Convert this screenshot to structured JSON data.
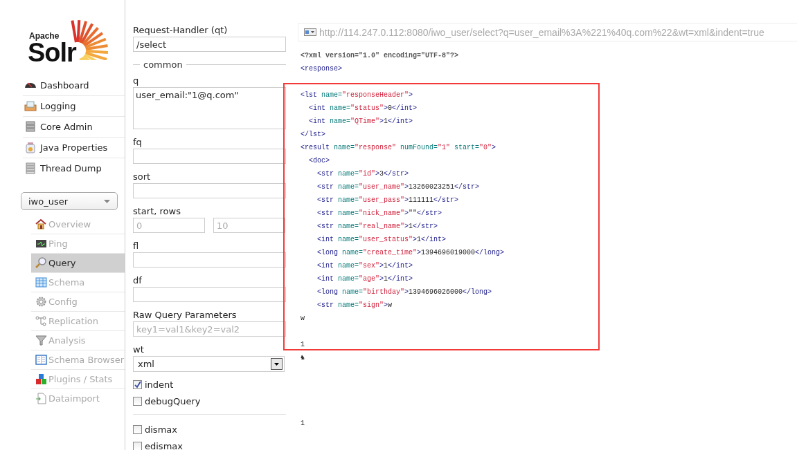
{
  "logo": {
    "small": "Apache",
    "big": "Solr"
  },
  "nav": [
    {
      "label": "Dashboard"
    },
    {
      "label": "Logging"
    },
    {
      "label": "Core Admin"
    },
    {
      "label": "Java Properties"
    },
    {
      "label": "Thread Dump"
    }
  ],
  "core_selector": {
    "value": "iwo_user"
  },
  "core_menu": [
    {
      "label": "Overview",
      "selected": false
    },
    {
      "label": "Ping",
      "selected": false
    },
    {
      "label": "Query",
      "selected": true
    },
    {
      "label": "Schema",
      "selected": false
    },
    {
      "label": "Config",
      "selected": false
    },
    {
      "label": "Replication",
      "selected": false
    },
    {
      "label": "Analysis",
      "selected": false
    },
    {
      "label": "Schema Browser",
      "selected": false
    },
    {
      "label": "Plugins / Stats",
      "selected": false
    },
    {
      "label": "Dataimport",
      "selected": false
    }
  ],
  "form": [
    {
      "kind": "text",
      "label": "Request-Handler (qt)",
      "value": "/select"
    },
    {
      "kind": "legend",
      "label": "common"
    },
    {
      "kind": "textarea",
      "label": "q",
      "value": "user_email:\"1@q.com\""
    },
    {
      "kind": "text",
      "label": "fq"
    },
    {
      "kind": "text",
      "label": "sort"
    },
    {
      "kind": "pair",
      "label": "start, rows",
      "placeholders": [
        "0",
        "10"
      ]
    },
    {
      "kind": "text",
      "label": "fl"
    },
    {
      "kind": "text",
      "label": "df"
    },
    {
      "kind": "text",
      "label": "Raw Query Parameters",
      "placeholder": "key1=val1&key2=val2"
    },
    {
      "kind": "select",
      "label": "wt",
      "value": "xml"
    },
    {
      "kind": "checkbox",
      "label": "indent",
      "checked": true
    },
    {
      "kind": "checkbox",
      "label": "debugQuery",
      "checked": false
    },
    {
      "kind": "divider"
    },
    {
      "kind": "checkbox",
      "label": "dismax",
      "checked": false
    },
    {
      "kind": "checkbox",
      "label": "edismax",
      "checked": false
    }
  ],
  "url": "http://114.247.0.112:8080/iwo_user/select?q=user_email%3A%221%40q.com%22&wt=xml&indent=true",
  "result": [
    {
      "kind": "line",
      "parts": [
        {
          "kind": "decl",
          "text": "<?xml version=\"1.0\" encoding=\"UTF-8\"?>"
        }
      ]
    },
    {
      "kind": "line",
      "parts": [
        {
          "kind": "tag",
          "text": "<response>"
        }
      ]
    },
    {
      "kind": "blank"
    },
    {
      "kind": "line",
      "parts": [
        {
          "kind": "tag",
          "text": "<lst "
        },
        {
          "kind": "attr",
          "text": "name="
        },
        {
          "kind": "value",
          "text": "\"responseHeader\""
        },
        {
          "kind": "tag",
          "text": ">"
        }
      ],
      "children": [
        {
          "kind": "line",
          "parts": [
            {
              "kind": "tag",
              "text": "<int "
            },
            {
              "kind": "attr",
              "text": "name="
            },
            {
              "kind": "value",
              "text": "\"status\""
            },
            {
              "kind": "tag",
              "text": ">"
            },
            {
              "kind": "text",
              "text": "0"
            },
            {
              "kind": "tag",
              "text": "</int>"
            }
          ]
        },
        {
          "kind": "line",
          "parts": [
            {
              "kind": "tag",
              "text": "<int "
            },
            {
              "kind": "attr",
              "text": "name="
            },
            {
              "kind": "value",
              "text": "\"QTime\""
            },
            {
              "kind": "tag",
              "text": ">"
            },
            {
              "kind": "text",
              "text": "1"
            },
            {
              "kind": "tag",
              "text": "</int>"
            }
          ]
        }
      ]
    },
    {
      "kind": "line",
      "parts": [
        {
          "kind": "tag",
          "text": "</lst>"
        }
      ]
    },
    {
      "kind": "line",
      "parts": [
        {
          "kind": "tag",
          "text": "<result "
        },
        {
          "kind": "attr",
          "text": "name="
        },
        {
          "kind": "value",
          "text": "\"response\""
        },
        {
          "kind": "attr",
          "text": " numFound="
        },
        {
          "kind": "value",
          "text": "\"1\""
        },
        {
          "kind": "attr",
          "text": " start="
        },
        {
          "kind": "value",
          "text": "\"0\""
        },
        {
          "kind": "tag",
          "text": ">"
        }
      ],
      "children": [
        {
          "kind": "line",
          "parts": [
            {
              "kind": "tag",
              "text": "<doc>"
            }
          ],
          "children": [
            {
              "kind": "line",
              "parts": [
                {
                  "kind": "tag",
                  "text": "<str "
                },
                {
                  "kind": "attr",
                  "text": "name="
                },
                {
                  "kind": "value",
                  "text": "\"id\""
                },
                {
                  "kind": "tag",
                  "text": ">"
                },
                {
                  "kind": "text",
                  "text": "3"
                },
                {
                  "kind": "tag",
                  "text": "</str>"
                }
              ]
            },
            {
              "kind": "line",
              "parts": [
                {
                  "kind": "tag",
                  "text": "<str "
                },
                {
                  "kind": "attr",
                  "text": "name="
                },
                {
                  "kind": "value",
                  "text": "\"user_name\""
                },
                {
                  "kind": "tag",
                  "text": ">"
                },
                {
                  "kind": "text",
                  "text": "13260023251"
                },
                {
                  "kind": "tag",
                  "text": "</str>"
                }
              ]
            },
            {
              "kind": "line",
              "parts": [
                {
                  "kind": "tag",
                  "text": "<str "
                },
                {
                  "kind": "attr",
                  "text": "name="
                },
                {
                  "kind": "value",
                  "text": "\"user_pass\""
                },
                {
                  "kind": "tag",
                  "text": ">"
                },
                {
                  "kind": "text",
                  "text": "111111"
                },
                {
                  "kind": "tag",
                  "text": "</str>"
                }
              ]
            },
            {
              "kind": "line",
              "parts": [
                {
                  "kind": "tag",
                  "text": "<str "
                },
                {
                  "kind": "attr",
                  "text": "name="
                },
                {
                  "kind": "value",
                  "text": "\"nick_name\""
                },
                {
                  "kind": "tag",
                  "text": ">"
                },
                {
                  "kind": "text",
                  "text": "\"\""
                },
                {
                  "kind": "tag",
                  "text": "</str>"
                }
              ]
            },
            {
              "kind": "line",
              "parts": [
                {
                  "kind": "tag",
                  "text": "<str "
                },
                {
                  "kind": "attr",
                  "text": "name="
                },
                {
                  "kind": "value",
                  "text": "\"real_name\""
                },
                {
                  "kind": "tag",
                  "text": ">"
                },
                {
                  "kind": "text",
                  "text": "1"
                },
                {
                  "kind": "tag",
                  "text": "</str>"
                }
              ]
            },
            {
              "kind": "line",
              "parts": [
                {
                  "kind": "tag",
                  "text": "<int "
                },
                {
                  "kind": "attr",
                  "text": "name="
                },
                {
                  "kind": "value",
                  "text": "\"user_status\""
                },
                {
                  "kind": "tag",
                  "text": ">"
                },
                {
                  "kind": "text",
                  "text": "1"
                },
                {
                  "kind": "tag",
                  "text": "</int>"
                }
              ]
            },
            {
              "kind": "line",
              "parts": [
                {
                  "kind": "tag",
                  "text": "<long "
                },
                {
                  "kind": "attr",
                  "text": "name="
                },
                {
                  "kind": "value",
                  "text": "\"create_time\""
                },
                {
                  "kind": "tag",
                  "text": ">"
                },
                {
                  "kind": "text",
                  "text": "1394696019000"
                },
                {
                  "kind": "tag",
                  "text": "</long>"
                }
              ]
            },
            {
              "kind": "line",
              "parts": [
                {
                  "kind": "tag",
                  "text": "<int "
                },
                {
                  "kind": "attr",
                  "text": "name="
                },
                {
                  "kind": "value",
                  "text": "\"sex\""
                },
                {
                  "kind": "tag",
                  "text": ">"
                },
                {
                  "kind": "text",
                  "text": "1"
                },
                {
                  "kind": "tag",
                  "text": "</int>"
                }
              ]
            },
            {
              "kind": "line",
              "parts": [
                {
                  "kind": "tag",
                  "text": "<int "
                },
                {
                  "kind": "attr",
                  "text": "name="
                },
                {
                  "kind": "value",
                  "text": "\"age\""
                },
                {
                  "kind": "tag",
                  "text": ">"
                },
                {
                  "kind": "text",
                  "text": "1"
                },
                {
                  "kind": "tag",
                  "text": "</int>"
                }
              ]
            },
            {
              "kind": "line",
              "parts": [
                {
                  "kind": "tag",
                  "text": "<long "
                },
                {
                  "kind": "attr",
                  "text": "name="
                },
                {
                  "kind": "value",
                  "text": "\"birthday\""
                },
                {
                  "kind": "tag",
                  "text": ">"
                },
                {
                  "kind": "text",
                  "text": "1394696026000"
                },
                {
                  "kind": "tag",
                  "text": "</long>"
                }
              ]
            },
            {
              "kind": "line",
              "parts": [
                {
                  "kind": "tag",
                  "text": "<str "
                },
                {
                  "kind": "attr",
                  "text": "name="
                },
                {
                  "kind": "value",
                  "text": "\"sign\""
                },
                {
                  "kind": "tag",
                  "text": ">"
                },
                {
                  "kind": "text",
                  "text": "w"
                }
              ]
            }
          ]
        }
      ]
    },
    {
      "kind": "line",
      "parts": [
        {
          "kind": "text",
          "text": "w"
        }
      ]
    },
    {
      "kind": "blank"
    },
    {
      "kind": "line",
      "parts": [
        {
          "kind": "text",
          "text": "1"
        }
      ]
    },
    {
      "kind": "line",
      "parts": [
        {
          "kind": "text",
          "text": "♞"
        }
      ]
    },
    {
      "kind": "blank"
    },
    {
      "kind": "blank"
    },
    {
      "kind": "blank"
    },
    {
      "kind": "blank"
    },
    {
      "kind": "line",
      "parts": [
        {
          "kind": "text",
          "text": "1"
        }
      ]
    }
  ]
}
